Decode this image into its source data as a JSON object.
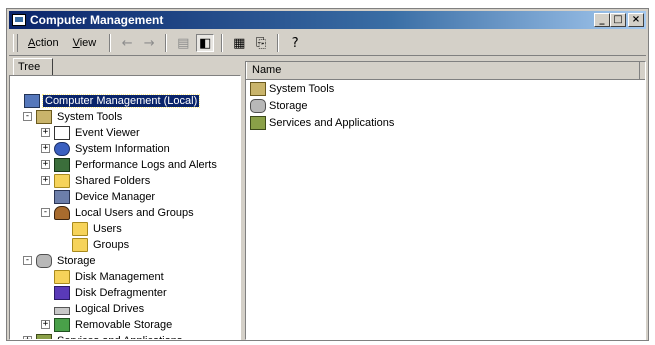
{
  "window": {
    "title": "Computer Management",
    "buttons": {
      "minimize": "_",
      "maximize": "□",
      "close": "×"
    }
  },
  "toolbar": {
    "menu": [
      {
        "label": "Action"
      },
      {
        "label": "View"
      }
    ],
    "icons": [
      "back-arrow-icon",
      "forward-arrow-icon",
      "up-folder-icon",
      "show-hide-tree-icon",
      "properties-icon",
      "export-list-icon",
      "help-icon"
    ]
  },
  "left_pane": {
    "tab_label": "Tree",
    "tree": [
      {
        "label": "Computer Management (Local)",
        "level": 0,
        "expander": "",
        "icon": "computer-icon",
        "selected": true
      },
      {
        "label": "System Tools",
        "level": 1,
        "expander": "-",
        "icon": "tools-icon"
      },
      {
        "label": "Event Viewer",
        "level": 2,
        "expander": "+",
        "icon": "event-viewer-icon"
      },
      {
        "label": "System Information",
        "level": 2,
        "expander": "+",
        "icon": "system-info-icon"
      },
      {
        "label": "Performance Logs and Alerts",
        "level": 2,
        "expander": "+",
        "icon": "performance-icon"
      },
      {
        "label": "Shared Folders",
        "level": 2,
        "expander": "+",
        "icon": "shared-folder-icon"
      },
      {
        "label": "Device Manager",
        "level": 2,
        "expander": "",
        "icon": "device-manager-icon"
      },
      {
        "label": "Local Users and Groups",
        "level": 2,
        "expander": "-",
        "icon": "users-groups-icon"
      },
      {
        "label": "Users",
        "level": 3,
        "expander": "",
        "icon": "folder-icon"
      },
      {
        "label": "Groups",
        "level": 3,
        "expander": "",
        "icon": "folder-icon"
      },
      {
        "label": "Storage",
        "level": 1,
        "expander": "-",
        "icon": "storage-icon"
      },
      {
        "label": "Disk Management",
        "level": 2,
        "expander": "",
        "icon": "disk-management-icon"
      },
      {
        "label": "Disk Defragmenter",
        "level": 2,
        "expander": "",
        "icon": "defragmenter-icon"
      },
      {
        "label": "Logical Drives",
        "level": 2,
        "expander": "",
        "icon": "logical-drives-icon"
      },
      {
        "label": "Removable Storage",
        "level": 2,
        "expander": "+",
        "icon": "removable-storage-icon"
      },
      {
        "label": "Services and Applications",
        "level": 1,
        "expander": "+",
        "icon": "services-icon"
      }
    ]
  },
  "right_pane": {
    "column_header": "Name",
    "items": [
      {
        "label": "System Tools",
        "icon": "tools-icon"
      },
      {
        "label": "Storage",
        "icon": "storage-icon"
      },
      {
        "label": "Services and Applications",
        "icon": "services-icon"
      }
    ]
  }
}
